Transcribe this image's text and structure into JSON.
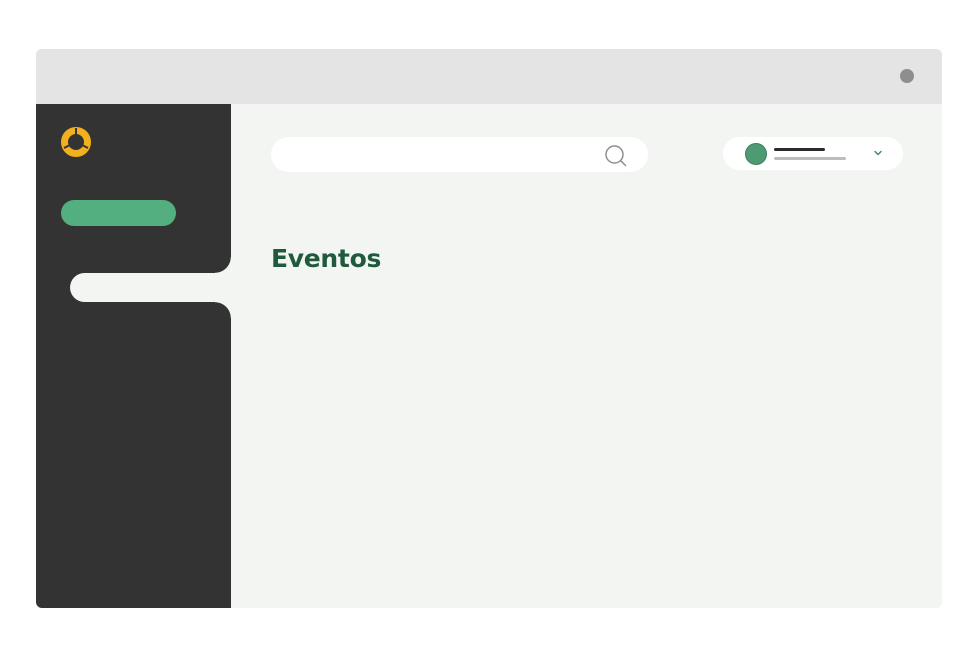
{
  "window": {
    "title": ""
  },
  "sidebar": {
    "logo_icon": "orange-ring-logo-icon",
    "items": [
      {
        "label": "",
        "state": "highlight",
        "color": "#54af80"
      },
      {
        "label": "",
        "state": "active"
      }
    ]
  },
  "header": {
    "search": {
      "value": "",
      "placeholder": "",
      "icon": "search-icon"
    },
    "user_menu": {
      "avatar_color": "#4e9b73",
      "icon": "chevron-down-icon"
    }
  },
  "main": {
    "title": "Eventos"
  },
  "colors": {
    "sidebar_bg": "#333333",
    "accent": "#54af80",
    "title": "#1f5a3d",
    "logo": "#f2b01e",
    "content_bg": "#f3f5f2"
  }
}
